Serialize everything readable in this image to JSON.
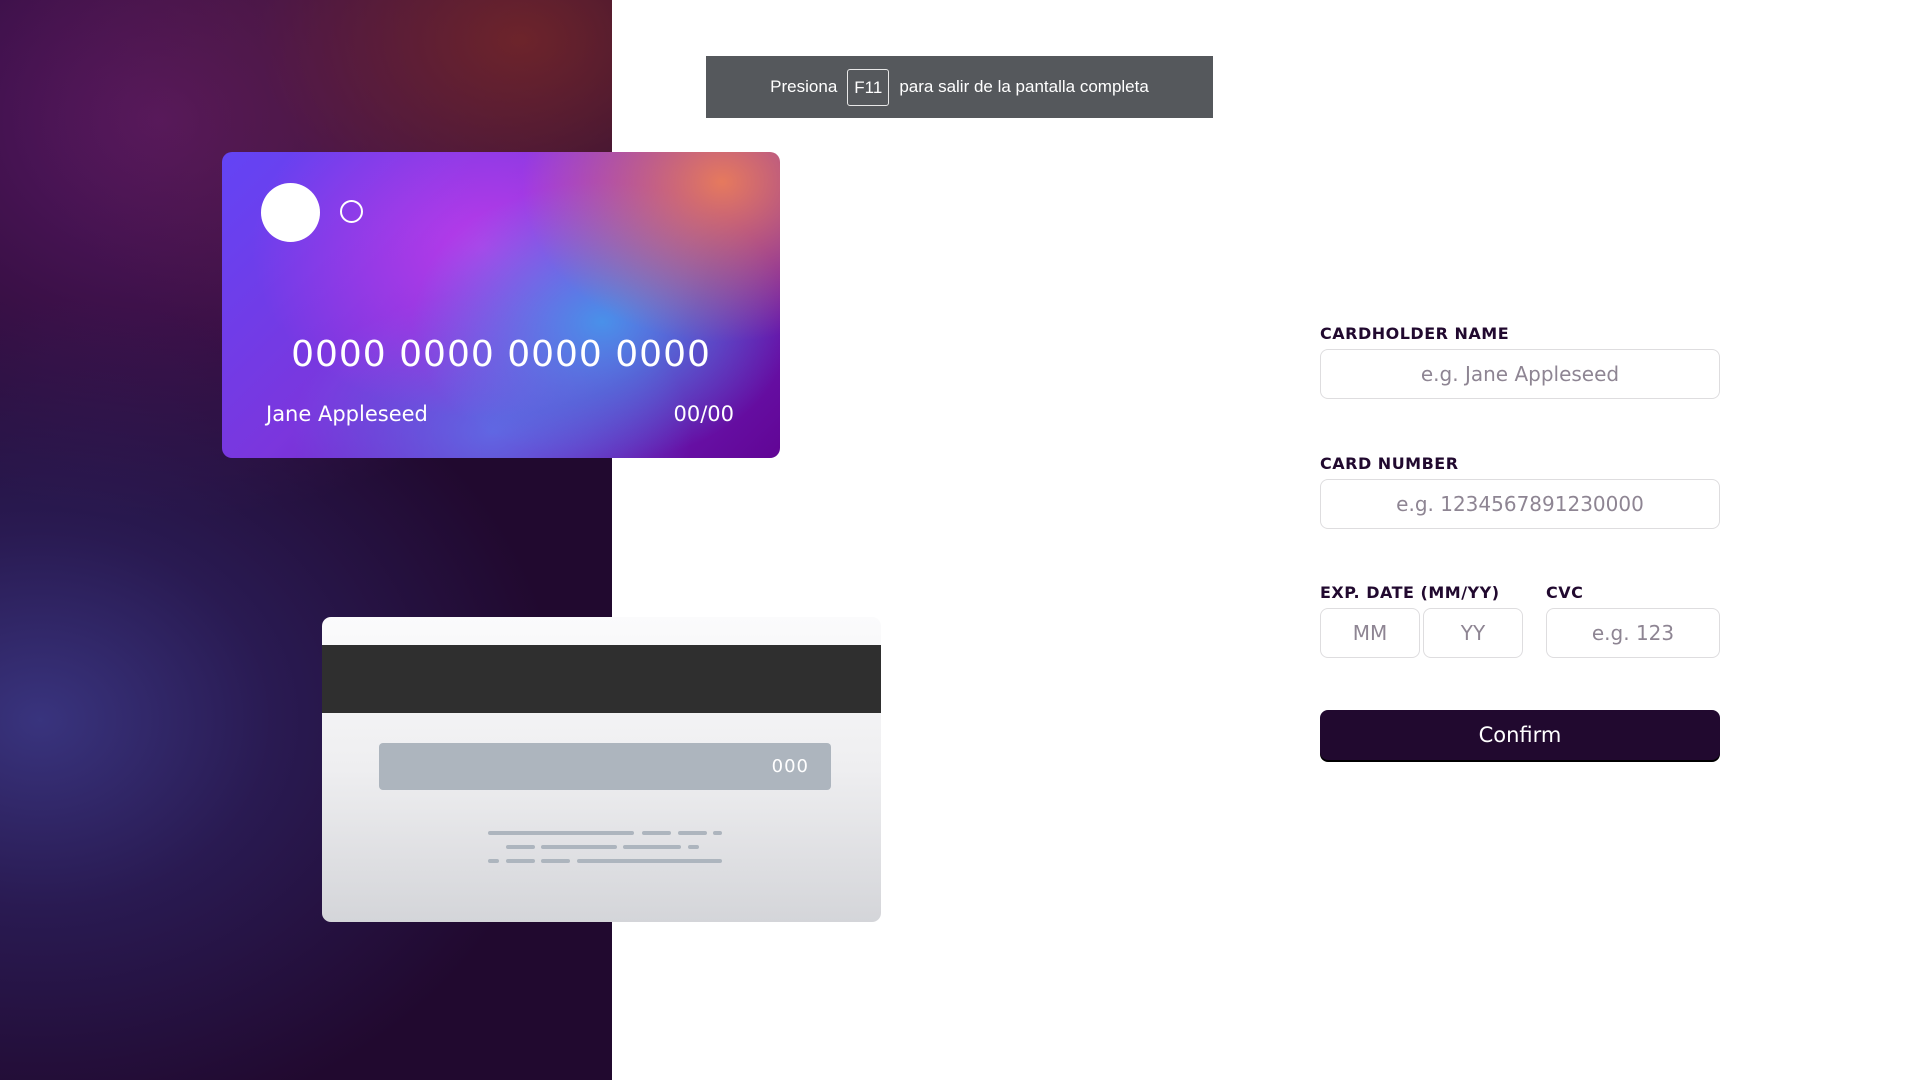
{
  "banner": {
    "before": "Presiona",
    "key": "F11",
    "after": "para salir de la pantalla completa"
  },
  "card_front": {
    "number": "0000 0000 0000 0000",
    "name": "Jane Appleseed",
    "expiry": "00/00"
  },
  "card_back": {
    "cvc": "000"
  },
  "form": {
    "name": {
      "label": "CARDHOLDER NAME",
      "placeholder": "e.g. Jane Appleseed"
    },
    "number": {
      "label": "CARD NUMBER",
      "placeholder": "e.g. 1234567891230000"
    },
    "exp": {
      "label": "EXP. DATE (MM/YY)",
      "mm_placeholder": "MM",
      "yy_placeholder": "YY"
    },
    "cvc": {
      "label": "CVC",
      "placeholder": "e.g. 123"
    },
    "confirm": "Confirm"
  },
  "colors": {
    "dark_violet": "#21092f",
    "border": "#dedddf",
    "placeholder": "#8e8593"
  }
}
